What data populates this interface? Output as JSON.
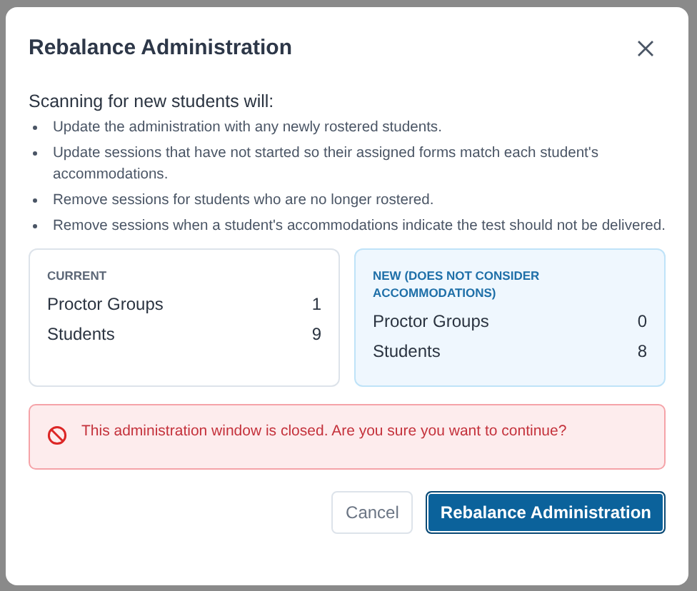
{
  "dialog": {
    "title": "Rebalance Administration",
    "intro": "Scanning for new students will:",
    "bullets": [
      "Update the administration with any newly rostered students.",
      "Update sessions that have not started so their assigned forms match each student's accommodations.",
      "Remove sessions for students who are no longer rostered.",
      "Remove sessions when a student's accommodations indicate the test should not be delivered."
    ],
    "panels": [
      {
        "heading": "CURRENT",
        "highlighted": false,
        "rows": [
          {
            "label": "Proctor Groups",
            "value": "1"
          },
          {
            "label": "Students",
            "value": "9"
          }
        ]
      },
      {
        "heading": "NEW (DOES NOT CONSIDER ACCOMMODATIONS)",
        "highlighted": true,
        "rows": [
          {
            "label": "Proctor Groups",
            "value": "0"
          },
          {
            "label": "Students",
            "value": "8"
          }
        ]
      }
    ],
    "alert": {
      "kind": "error",
      "message": "This administration window is closed. Are you sure you want to continue?"
    },
    "buttons": [
      {
        "label": "Cancel",
        "kind": "secondary"
      },
      {
        "label": "Rebalance Administration",
        "kind": "primary"
      }
    ]
  }
}
